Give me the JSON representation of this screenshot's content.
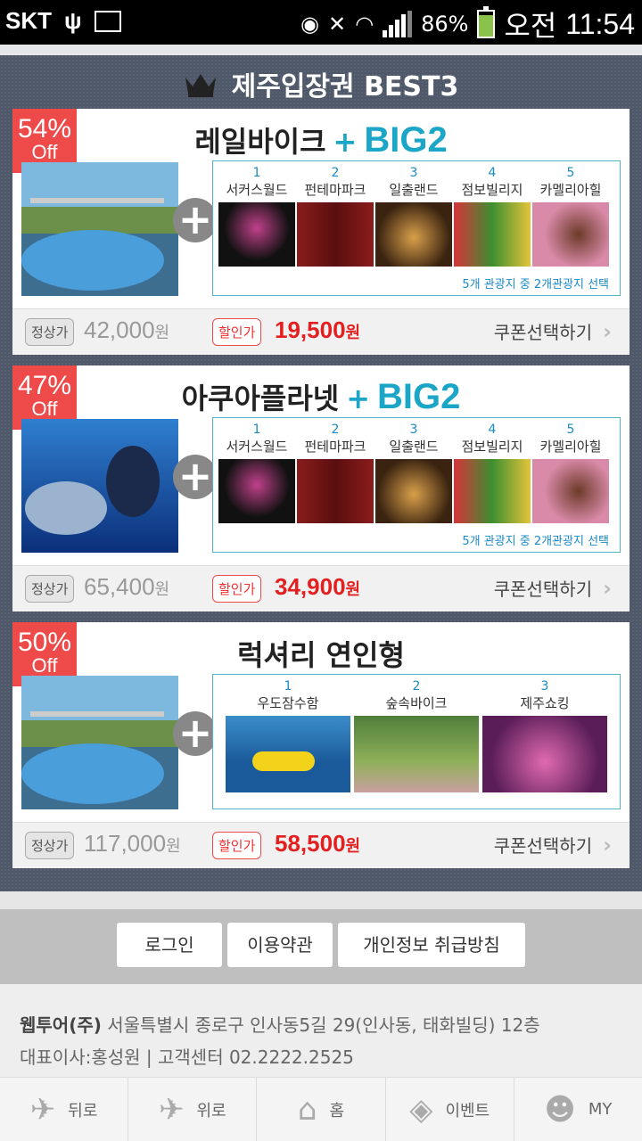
{
  "statusbar": {
    "carrier": "SKT",
    "battery": "86%",
    "ampm": "오전",
    "time": "11:54"
  },
  "page": {
    "title": "제주입장권 BEST3"
  },
  "big_options": {
    "items": [
      {
        "num": "1",
        "label": "서커스월드"
      },
      {
        "num": "2",
        "label": "펀테마파크"
      },
      {
        "num": "3",
        "label": "일출랜드"
      },
      {
        "num": "4",
        "label": "점보빌리지"
      },
      {
        "num": "5",
        "label": "카멜리아힐"
      }
    ],
    "note": "5개 관광지 중 2개관광지 선택"
  },
  "products": [
    {
      "discount": "54%",
      "off": "Off",
      "name": "레일바이크",
      "plus": "+",
      "big": "BIG2",
      "regular_label": "정상가",
      "regular_price": "42,000",
      "sale_label": "할인가",
      "sale_price": "19,500",
      "won": "원",
      "coupon": "쿠폰선택하기",
      "arrow": "›"
    },
    {
      "discount": "47%",
      "off": "Off",
      "name": "아쿠아플라넷",
      "plus": "+",
      "big": "BIG2",
      "regular_label": "정상가",
      "regular_price": "65,400",
      "sale_label": "할인가",
      "sale_price": "34,900",
      "won": "원",
      "coupon": "쿠폰선택하기",
      "arrow": "›"
    },
    {
      "discount": "50%",
      "off": "Off",
      "name": "럭셔리 연인형",
      "options": [
        {
          "num": "1",
          "label": "우도잠수함"
        },
        {
          "num": "2",
          "label": "숲속바이크"
        },
        {
          "num": "3",
          "label": "제주쇼킹"
        }
      ],
      "regular_label": "정상가",
      "regular_price": "117,000",
      "sale_label": "할인가",
      "sale_price": "58,500",
      "won": "원",
      "coupon": "쿠폰선택하기",
      "arrow": "›"
    }
  ],
  "footer": {
    "buttons": {
      "login": "로그인",
      "terms": "이용약관",
      "privacy": "개인정보 취급방침"
    },
    "company_name": "웹투어(주)",
    "address": "서울특별시 종로구 인사동5길 29(인사동, 태화빌딩) 12층",
    "ceo_line": "대표이사:홍성원 | 고객센터 02.2222.2525"
  },
  "nav": {
    "back": "뒤로",
    "top": "위로",
    "home": "홈",
    "event": "이벤트",
    "my": "MY"
  }
}
